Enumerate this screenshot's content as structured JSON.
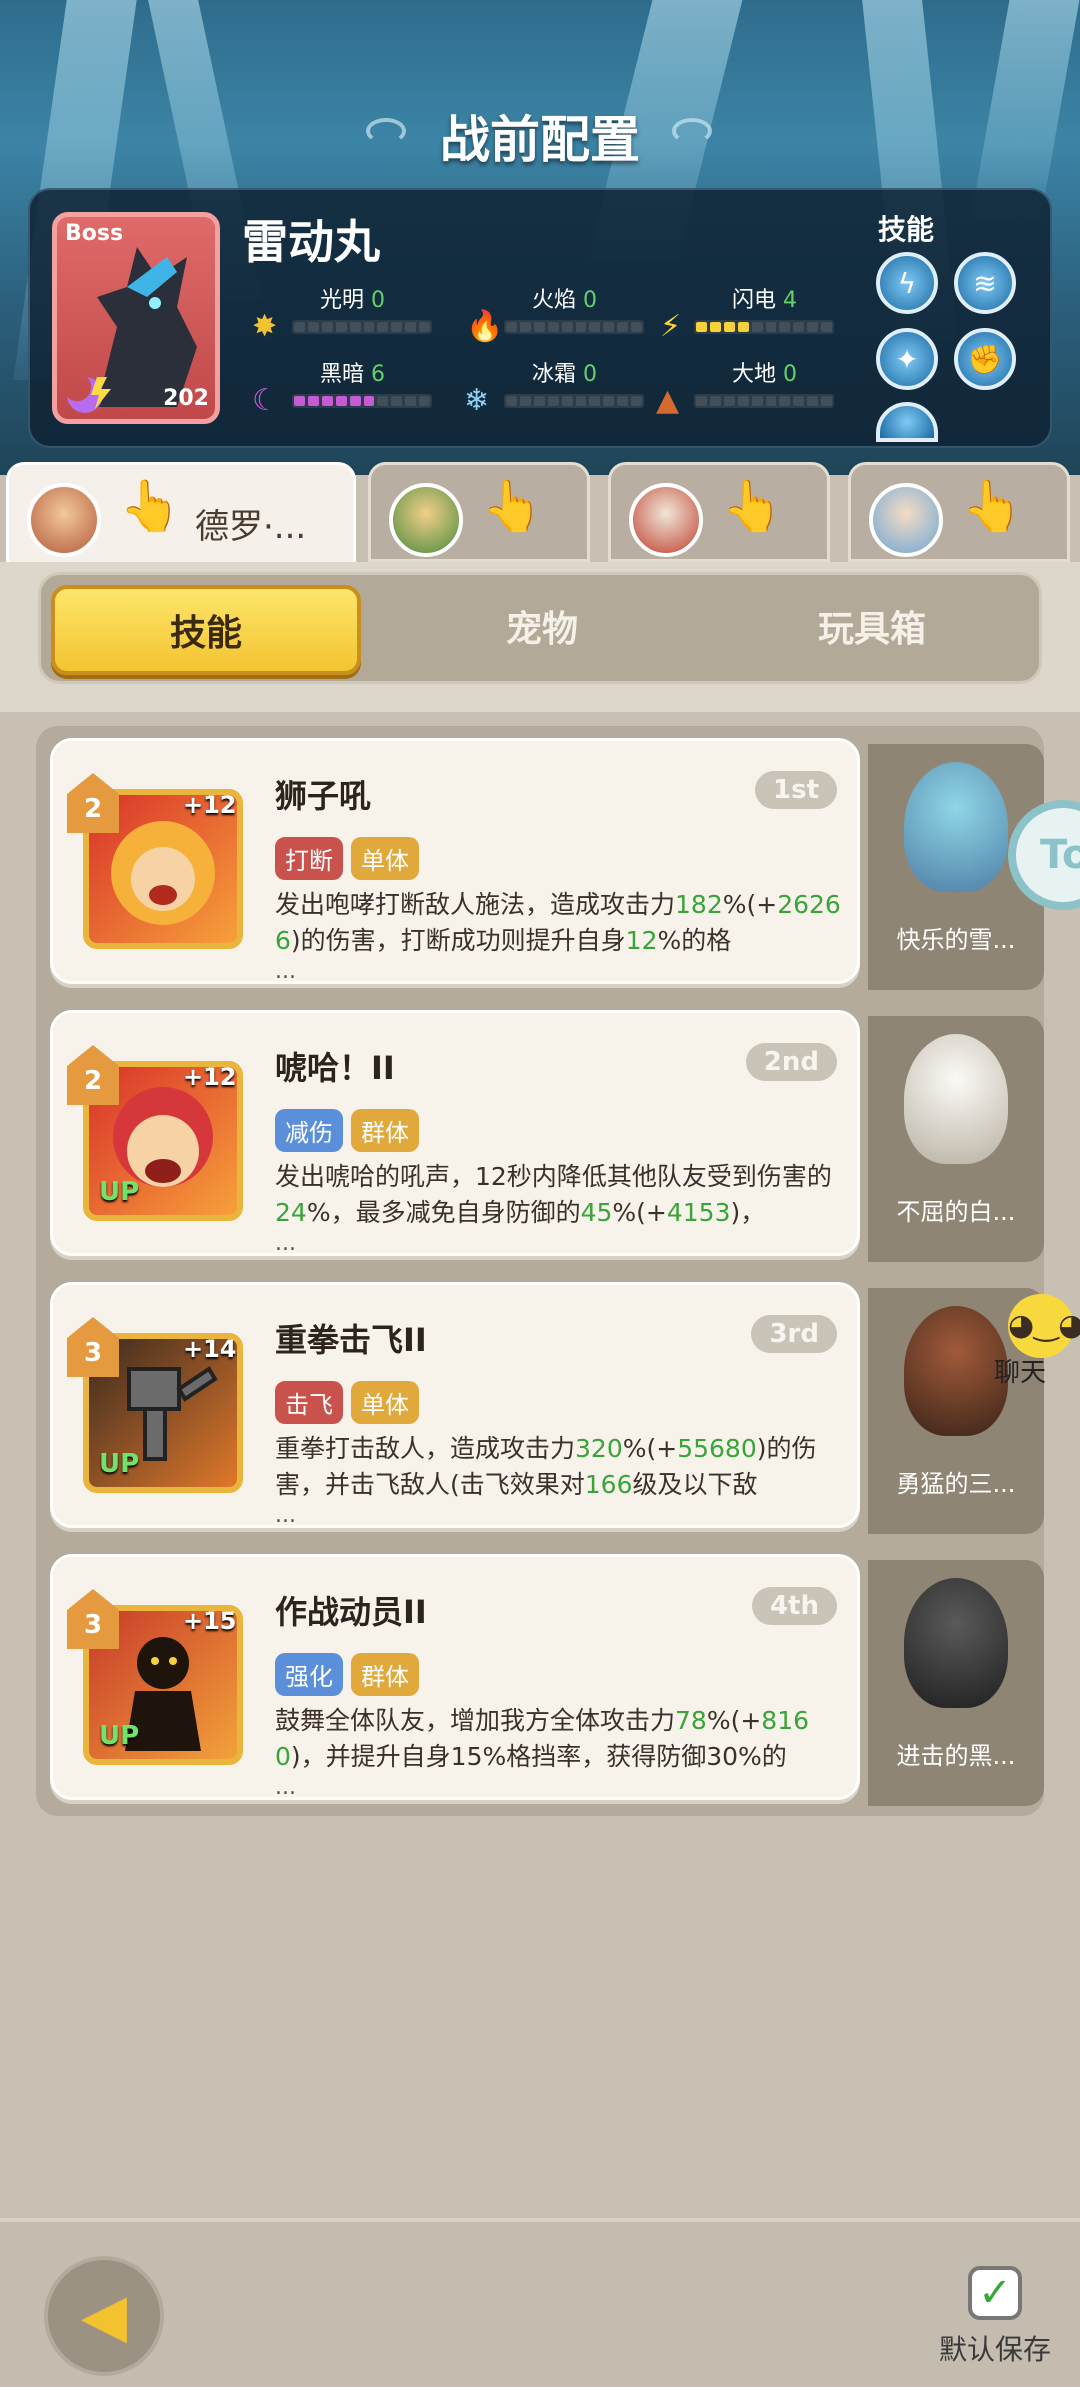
{
  "page_title": "战前配置",
  "boss": {
    "badge": "Boss",
    "name": "雷动丸",
    "level": "202",
    "skills_label": "技能",
    "attributes": [
      {
        "label": "光明",
        "value": "0",
        "filled": 0
      },
      {
        "label": "火焰",
        "value": "0",
        "filled": 0
      },
      {
        "label": "闪电",
        "value": "4",
        "filled": 4
      },
      {
        "label": "黑暗",
        "value": "6",
        "filled": 6
      },
      {
        "label": "冰霜",
        "value": "0",
        "filled": 0
      },
      {
        "label": "大地",
        "value": "0",
        "filled": 0
      }
    ],
    "attribute_colors": {
      "light": "#f2c230",
      "fire": "#e2442e",
      "thunder": "#f7d23b",
      "dark": "#c65bd6",
      "frost": "#8fd2f2",
      "earth": "#d46a2e"
    },
    "skill_icons": [
      "lightning-icon",
      "wind-icon",
      "wing-icon",
      "fist-icon",
      "partial-skill-icon"
    ]
  },
  "hero_tabs": [
    {
      "name": "德罗·...",
      "icon": "hand-tap-icon"
    },
    {
      "name": "",
      "icon": "hand-tap-icon"
    },
    {
      "name": "",
      "icon": "hand-tap-icon"
    },
    {
      "name": "",
      "icon": "hand-tap-icon"
    }
  ],
  "segments": [
    "技能",
    "宠物",
    "玩具箱"
  ],
  "active_segment": "技能",
  "skills": [
    {
      "level": "2",
      "bonus": "+12",
      "up": "",
      "rank": "1st",
      "name": "狮子吼",
      "tags": [
        {
          "text": "打断",
          "color": "red"
        },
        {
          "text": "单体",
          "color": "gold"
        }
      ],
      "desc_parts": [
        {
          "t": "发出咆哮打断敌人施法，造成攻击力",
          "c": "n"
        },
        {
          "t": "182",
          "c": "g"
        },
        {
          "t": "%(+",
          "c": "n"
        },
        {
          "t": "26266",
          "c": "g"
        },
        {
          "t": ")的伤害，打断成功则提升自身",
          "c": "n"
        },
        {
          "t": "12",
          "c": "g"
        },
        {
          "t": "%的格",
          "c": "n"
        }
      ],
      "pet": "快乐的雪..."
    },
    {
      "level": "2",
      "bonus": "+12",
      "up": "UP",
      "rank": "2nd",
      "name": "唬哈！II",
      "tags": [
        {
          "text": "减伤",
          "color": "blue"
        },
        {
          "text": "群体",
          "color": "gold"
        }
      ],
      "desc_parts": [
        {
          "t": "发出唬哈的吼声，12秒内降低其他队友受到伤害的",
          "c": "n"
        },
        {
          "t": "24",
          "c": "g"
        },
        {
          "t": "%，最多减免自身防御的",
          "c": "n"
        },
        {
          "t": "45",
          "c": "g"
        },
        {
          "t": "%(+",
          "c": "n"
        },
        {
          "t": "4153",
          "c": "g"
        },
        {
          "t": ")，",
          "c": "n"
        }
      ],
      "pet": "不屈的白..."
    },
    {
      "level": "3",
      "bonus": "+14",
      "up": "UP",
      "rank": "3rd",
      "name": "重拳击飞II",
      "tags": [
        {
          "text": "击飞",
          "color": "red"
        },
        {
          "text": "单体",
          "color": "gold"
        }
      ],
      "desc_parts": [
        {
          "t": "重拳打击敌人，造成攻击力",
          "c": "n"
        },
        {
          "t": "320",
          "c": "g"
        },
        {
          "t": "%(+",
          "c": "n"
        },
        {
          "t": "55680",
          "c": "g"
        },
        {
          "t": ")的伤害，并击飞敌人(击飞效果对",
          "c": "n"
        },
        {
          "t": "166",
          "c": "g"
        },
        {
          "t": "级及以下敌",
          "c": "n"
        }
      ],
      "pet": "勇猛的三..."
    },
    {
      "level": "3",
      "bonus": "+15",
      "up": "UP",
      "rank": "4th",
      "name": "作战动员II",
      "tags": [
        {
          "text": "强化",
          "color": "blue"
        },
        {
          "text": "群体",
          "color": "gold"
        }
      ],
      "desc_parts": [
        {
          "t": "鼓舞全体队友，增加我方全体攻击力",
          "c": "n"
        },
        {
          "t": "78",
          "c": "g"
        },
        {
          "t": "%(+",
          "c": "n"
        },
        {
          "t": "8160",
          "c": "g"
        },
        {
          "t": ")，并提升自身15%格挡率，获得防御30%的",
          "c": "n"
        }
      ],
      "pet": "进击的黑..."
    }
  ],
  "ellipsis": "...",
  "side_button": "To",
  "chat_label": "聊天",
  "save_label": "默认保存",
  "colors": {
    "green_number": "#3aa33a",
    "accent_gold": "#f4c431"
  }
}
